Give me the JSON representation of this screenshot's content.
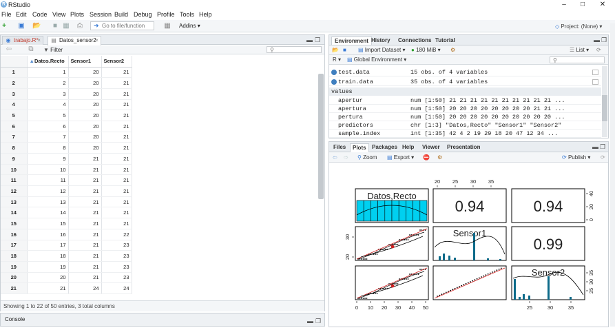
{
  "app": {
    "title": "RStudio",
    "project": "Project: (None)"
  },
  "menu": [
    "File",
    "Edit",
    "Code",
    "View",
    "Plots",
    "Session",
    "Build",
    "Debug",
    "Profile",
    "Tools",
    "Help"
  ],
  "toolbar": {
    "goto_placeholder": "Go to file/function",
    "addins": "Addins"
  },
  "source": {
    "tabs": [
      "trabajo.R*",
      "Datos_sensor2"
    ],
    "filter": "Filter",
    "columns": [
      "Datos.Recto",
      "Sensor1",
      "Sensor2"
    ],
    "rows": [
      [
        1,
        1,
        20,
        21
      ],
      [
        2,
        2,
        20,
        21
      ],
      [
        3,
        3,
        20,
        21
      ],
      [
        4,
        4,
        20,
        21
      ],
      [
        5,
        5,
        20,
        21
      ],
      [
        6,
        6,
        20,
        21
      ],
      [
        7,
        7,
        20,
        21
      ],
      [
        8,
        8,
        20,
        21
      ],
      [
        9,
        9,
        21,
        21
      ],
      [
        10,
        10,
        21,
        21
      ],
      [
        11,
        11,
        21,
        21
      ],
      [
        12,
        12,
        21,
        21
      ],
      [
        13,
        13,
        21,
        21
      ],
      [
        14,
        14,
        21,
        21
      ],
      [
        15,
        15,
        21,
        21
      ],
      [
        16,
        16,
        21,
        22
      ],
      [
        17,
        17,
        21,
        23
      ],
      [
        18,
        18,
        21,
        23
      ],
      [
        19,
        19,
        21,
        23
      ],
      [
        20,
        20,
        21,
        23
      ],
      [
        21,
        21,
        24,
        24
      ]
    ],
    "footer": "Showing 1 to 22 of 50 entries, 3 total columns"
  },
  "console": {
    "label": "Console"
  },
  "environment": {
    "tabs": [
      "Environment",
      "History",
      "Connections",
      "Tutorial"
    ],
    "import": "Import Dataset",
    "memory": "180 MiB",
    "list": "List",
    "scope": "Global Environment",
    "lang": "R",
    "data": [
      {
        "name": "test.data",
        "value": "15 obs. of 4 variables"
      },
      {
        "name": "train.data",
        "value": "35 obs. of 4 variables"
      }
    ],
    "values_header": "values",
    "values": [
      {
        "name": "apertur",
        "value": "num [1:50] 21 21 21 21 21 21 21 21 21 21 ..."
      },
      {
        "name": "apertura",
        "value": "num [1:50] 20 20 20 20 20 20 20 20 21 21 ..."
      },
      {
        "name": "pertura",
        "value": "num [1:50] 20 20 20 20 20 20 20 20 20 20 ..."
      },
      {
        "name": "predictors",
        "value": "chr [1:3] \"Datos,Recto\" \"Sensor1\" \"Sensor2\""
      },
      {
        "name": "sample.index",
        "value": "int [1:35] 42 4 2 19 29 18 20 47 12 34 ..."
      }
    ]
  },
  "plots": {
    "tabs": [
      "Files",
      "Plots",
      "Packages",
      "Help",
      "Viewer",
      "Presentation"
    ],
    "zoom": "Zoom",
    "export": "Export",
    "publish": "Publish",
    "panel_labels": [
      "Datos,Recto",
      "Sensor1",
      "Sensor2"
    ],
    "correlations": [
      "0.94",
      "0.94",
      "0.99"
    ],
    "top_ticks": [
      "20",
      "25",
      "30",
      "35"
    ],
    "right_ticks_top": [
      "0",
      "20",
      "40"
    ],
    "left_ticks_mid": [
      "20",
      "30"
    ],
    "right_ticks_bot": [
      "25",
      "30",
      "35"
    ],
    "bottom_ticks_left": [
      "0",
      "10",
      "20",
      "30",
      "40",
      "50"
    ],
    "bottom_ticks_right": [
      "25",
      "30",
      "35"
    ]
  },
  "chart_data": {
    "type": "scatter",
    "title": "",
    "variables": [
      "Datos,Recto",
      "Sensor1",
      "Sensor2"
    ],
    "correlations": {
      "Datos,Recto~Sensor1": 0.94,
      "Datos,Recto~Sensor2": 0.94,
      "Sensor1~Sensor2": 0.99
    },
    "ranges": {
      "Datos,Recto": [
        0,
        50
      ],
      "Sensor1": [
        20,
        37
      ],
      "Sensor2": [
        20,
        37
      ]
    },
    "colors": {
      "histogram": "#00d0f0",
      "fit": "#d02020",
      "points": "#000000"
    }
  }
}
